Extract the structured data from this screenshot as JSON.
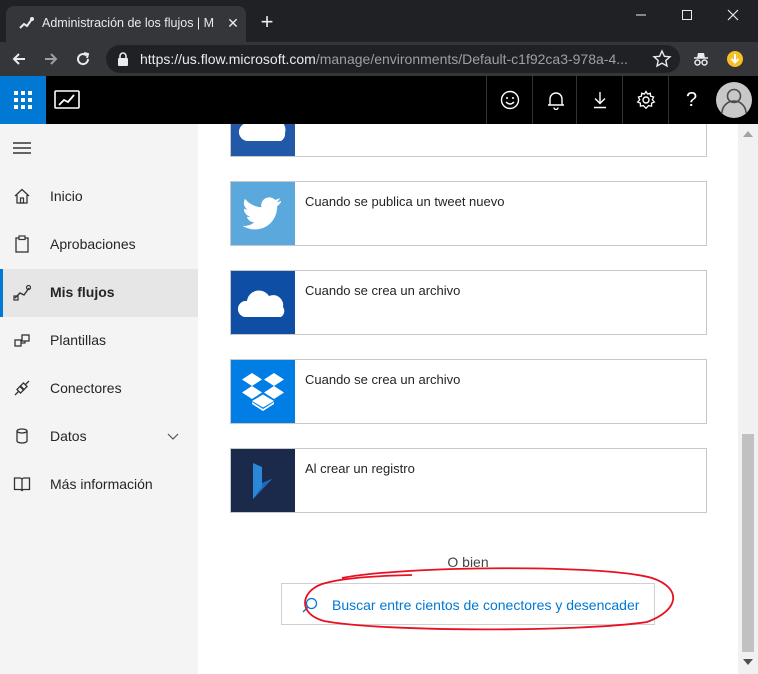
{
  "browser": {
    "tab_title": "Administración de los flujos | Microsoft Flow",
    "url_host": "https://us.flow.microsoft.com",
    "url_path": "/manage/environments/Default-c1f92ca3-978a-4..."
  },
  "nav": {
    "items": [
      {
        "label": "Inicio",
        "icon": "home-icon"
      },
      {
        "label": "Aprobaciones",
        "icon": "clipboard-icon"
      },
      {
        "label": "Mis flujos",
        "icon": "flow-icon",
        "active": true
      },
      {
        "label": "Plantillas",
        "icon": "templates-icon"
      },
      {
        "label": "Conectores",
        "icon": "plug-icon"
      },
      {
        "label": "Datos",
        "icon": "database-icon"
      },
      {
        "label": "Más información",
        "icon": "book-icon"
      }
    ]
  },
  "triggers": [
    {
      "label": "",
      "service": "OneDrive",
      "color": "#2158a8"
    },
    {
      "label": "Cuando se publica un tweet nuevo",
      "service": "Twitter",
      "color": "#5ba8dd"
    },
    {
      "label": "Cuando se crea un archivo",
      "service": "OneDrive",
      "color": "#0f4ea5"
    },
    {
      "label": "Cuando se crea un archivo",
      "service": "Dropbox",
      "color": "#007ee5"
    },
    {
      "label": "Al crear un registro",
      "service": "Dynamics 365",
      "color": "#1b2a4a"
    }
  ],
  "or_text": "O bien",
  "search": {
    "placeholder": "Buscar entre cientos de conectores y desencader"
  },
  "colors": {
    "accent": "#0078d4",
    "highlight": "#e81123"
  }
}
